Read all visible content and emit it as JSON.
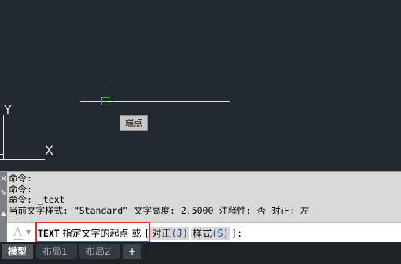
{
  "canvas": {
    "snap_tooltip": "端点",
    "ucs": {
      "x_label": "X",
      "y_label": "Y"
    }
  },
  "command_line": {
    "history": [
      "命令:",
      "命令:",
      "命令: _text",
      "当前文字样式: “Standard” 文字高度: 2.5000 注释性: 否 对正: 左"
    ],
    "prompt": {
      "command": "TEXT",
      "text": "指定文字的起点 或",
      "options_open": "[",
      "options": [
        {
          "label": "对正",
          "key": "(J)"
        },
        {
          "label": "样式",
          "key": "(S)"
        }
      ],
      "options_close": "]:"
    }
  },
  "layout_tabs": {
    "tabs": [
      "模型",
      "布局1",
      "布局2"
    ],
    "add_tab": "+"
  },
  "icons": {
    "command_icon": "text-a-icon",
    "dropdown": "chevron-down-icon",
    "panel_close": "close-icon",
    "panel_customize": "wrench-icon"
  },
  "colors": {
    "canvas_bg": "#212830",
    "snap_marker": "#22c422",
    "prompt_highlight": "#e0302c",
    "option_key": "#1e44c0"
  }
}
